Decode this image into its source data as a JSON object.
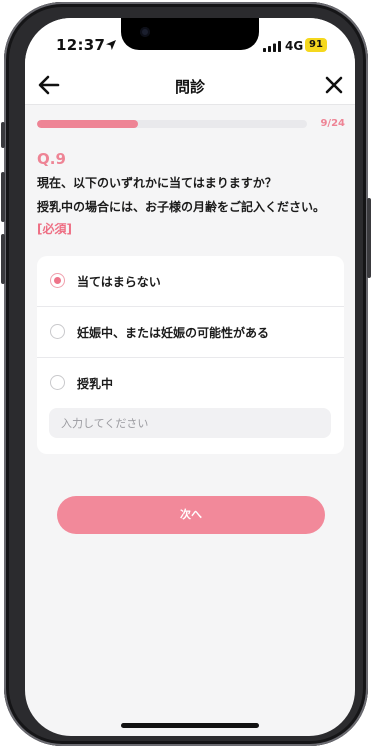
{
  "status_bar": {
    "time": "12:37",
    "network": "4G",
    "battery": "91"
  },
  "header": {
    "title": "問診",
    "back_icon": "arrow-left-icon",
    "close_icon": "close-icon"
  },
  "progress": {
    "current": 9,
    "total": 24,
    "text": "9/24",
    "fraction": 0.375,
    "color": "#ee8495"
  },
  "question": {
    "number": "Q.9",
    "line1": "現在、以下のいずれかに当てはまりますか？",
    "line2": "授乳中の場合には、お子様の月齢をご記入ください。",
    "required": "[必須]"
  },
  "options": [
    {
      "label": "当てはまらない",
      "selected": true
    },
    {
      "label": "妊娠中、または妊娠の可能性がある",
      "selected": false
    },
    {
      "label": "授乳中",
      "selected": false
    }
  ],
  "input": {
    "value": "",
    "placeholder": "入力してください"
  },
  "next_button": {
    "label": "次へ"
  },
  "colors": {
    "accent": "#ee8495",
    "button": "#f2899a",
    "battery": "#f5d81e"
  }
}
